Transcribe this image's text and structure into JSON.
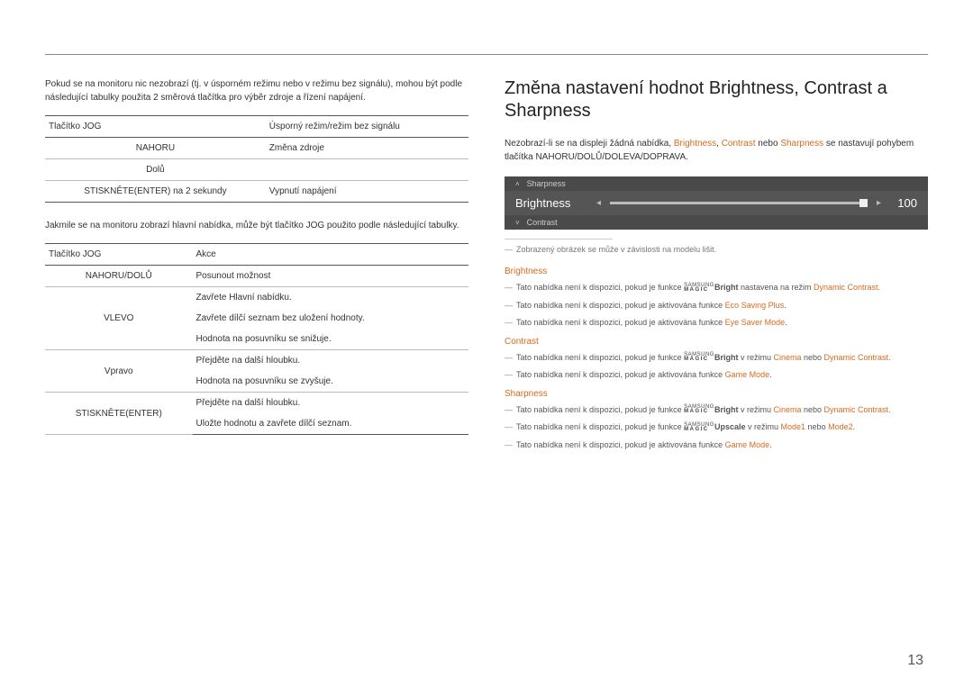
{
  "left": {
    "intro": "Pokud se na monitoru nic nezobrazí (tj. v úsporném režimu nebo v režimu bez signálu), mohou být podle následující tabulky použita 2 směrová tlačítka pro výběr zdroje a řízení napájení.",
    "table1": {
      "h1": "Tlačítko JOG",
      "h2": "Úsporný režim/režim bez signálu",
      "rows": [
        {
          "c1": "NAHORU",
          "c2": "Změna zdroje"
        },
        {
          "c1": "Dolů",
          "c2": ""
        },
        {
          "c1": "STISKNĚTE(ENTER) na 2 sekundy",
          "c2": "Vypnutí napájení"
        }
      ]
    },
    "mid": "Jakmile se na monitoru zobrazí hlavní nabídka, může být tlačítko JOG použito podle následující tabulky.",
    "table2": {
      "h1": "Tlačítko JOG",
      "h2": "Akce",
      "rows": [
        {
          "c1": "NAHORU/DOLŮ",
          "c2": "Posunout možnost"
        },
        {
          "c1": "VLEVO",
          "c2a": "Zavřete Hlavní nabídku.",
          "c2b": "Zavřete dílčí seznam bez uložení hodnoty.",
          "c2c": "Hodnota na posuvníku se snižuje."
        },
        {
          "c1": "Vpravo",
          "c2a": "Přejděte na další hloubku.",
          "c2b": "Hodnota na posuvníku se zvyšuje."
        },
        {
          "c1": "STISKNĚTE(ENTER)",
          "c2a": "Přejděte na další hloubku.",
          "c2b": "Uložte hodnotu a zavřete dílčí seznam."
        }
      ]
    }
  },
  "right": {
    "heading": "Změna nastavení hodnot Brightness, Contrast a Sharpness",
    "lead_a": "Nezobrazí-li se na displeji žádná nabídka, ",
    "lead_b": "Brightness",
    "lead_c": ", ",
    "lead_d": "Contrast",
    "lead_e": " nebo ",
    "lead_f": "Sharpness",
    "lead_g": " se nastavují pohybem tlačítka NAHORU/DOLŮ/DOLEVA/DOPRAVA.",
    "osd": {
      "top": "Sharpness",
      "main": "Brightness",
      "value": "100",
      "bottom": "Contrast"
    },
    "footnote": "Zobrazený obrázek se může v závislosti na modelu lišit.",
    "sections": {
      "brightness": {
        "title": "Brightness",
        "n1_a": "Tato nabídka není k dispozici, pokud je funkce ",
        "n1_b": "Bright",
        "n1_c": " nastavena na režim ",
        "n1_d": "Dynamic Contrast",
        "n2_a": "Tato nabídka není k dispozici, pokud je aktivována funkce ",
        "n2_b": "Eco Saving Plus",
        "n3_a": "Tato nabídka není k dispozici, pokud je aktivována funkce ",
        "n3_b": "Eye Saver Mode"
      },
      "contrast": {
        "title": "Contrast",
        "n1_a": "Tato nabídka není k dispozici, pokud je funkce ",
        "n1_b": "Bright",
        "n1_c": " v režimu ",
        "n1_d": "Cinema",
        "n1_e": " nebo ",
        "n1_f": "Dynamic Contrast",
        "n2_a": "Tato nabídka není k dispozici, pokud je aktivována funkce ",
        "n2_b": "Game Mode"
      },
      "sharpness": {
        "title": "Sharpness",
        "n1_a": "Tato nabídka není k dispozici, pokud je funkce ",
        "n1_b": "Bright",
        "n1_c": " v režimu ",
        "n1_d": "Cinema",
        "n1_e": " nebo ",
        "n1_f": "Dynamic Contrast",
        "n2_a": "Tato nabídka není k dispozici, pokud je funkce ",
        "n2_b": "Upscale",
        "n2_c": " v režimu ",
        "n2_d": "Mode1",
        "n2_e": " nebo ",
        "n2_f": "Mode2",
        "n3_a": "Tato nabídka není k dispozici, pokud je aktivována funkce ",
        "n3_b": "Game Mode"
      }
    }
  },
  "page": "13"
}
